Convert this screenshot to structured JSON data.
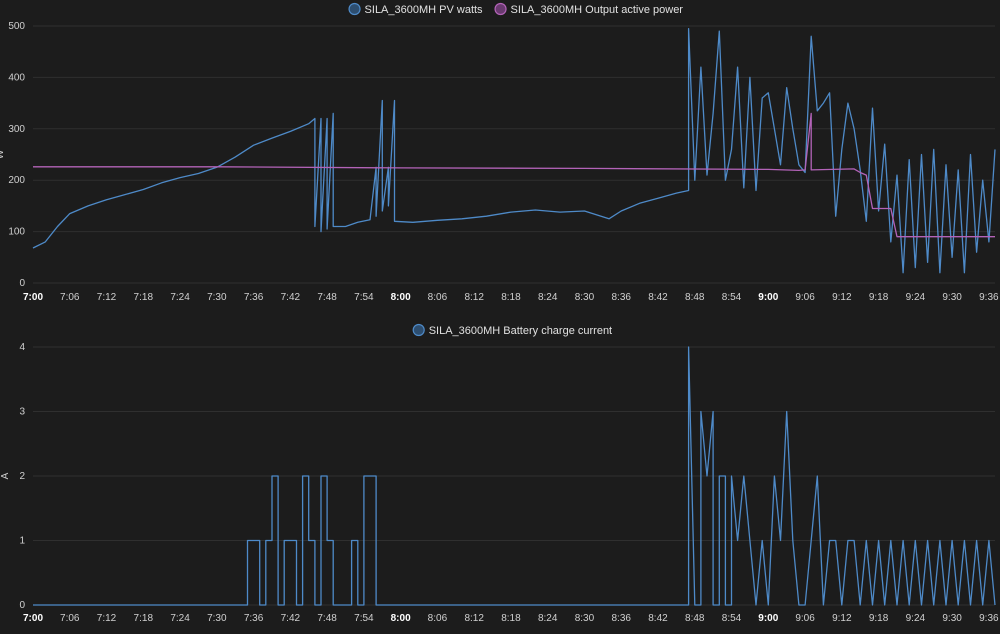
{
  "chart_data": [
    {
      "type": "line",
      "ylabel": "W",
      "ylim": [
        0,
        500
      ],
      "yticks": [
        "0",
        "100",
        "200",
        "300",
        "400",
        "500"
      ],
      "xlim": [
        "7:00",
        "9:37"
      ],
      "xticks": [
        "7:00",
        "7:06",
        "7:12",
        "7:18",
        "7:24",
        "7:30",
        "7:36",
        "7:42",
        "7:48",
        "7:54",
        "8:00",
        "8:06",
        "8:12",
        "8:18",
        "8:24",
        "8:30",
        "8:36",
        "8:42",
        "8:48",
        "8:54",
        "9:00",
        "9:06",
        "9:12",
        "9:18",
        "9:24",
        "9:30",
        "9:36"
      ],
      "bold_ticks": [
        "7:00",
        "8:00",
        "9:00"
      ],
      "legend_placement": "top-center",
      "grid": true,
      "series": [
        {
          "name": "SILA_3600MH PV watts",
          "color": "#4e8ac8",
          "points": [
            [
              "7:00",
              68
            ],
            [
              "7:02",
              80
            ],
            [
              "7:04",
              110
            ],
            [
              "7:06",
              135
            ],
            [
              "7:09",
              150
            ],
            [
              "7:12",
              162
            ],
            [
              "7:15",
              172
            ],
            [
              "7:18",
              182
            ],
            [
              "7:21",
              195
            ],
            [
              "7:24",
              205
            ],
            [
              "7:27",
              213
            ],
            [
              "7:30",
              225
            ],
            [
              "7:33",
              245
            ],
            [
              "7:36",
              268
            ],
            [
              "7:39",
              282
            ],
            [
              "7:42",
              295
            ],
            [
              "7:45",
              310
            ],
            [
              "7:46",
              320
            ],
            [
              "7:46",
              110
            ],
            [
              "7:47",
              320
            ],
            [
              "7:47",
              100
            ],
            [
              "7:48",
              320
            ],
            [
              "7:48",
              105
            ],
            [
              "7:49",
              330
            ],
            [
              "7:49",
              110
            ],
            [
              "7:51",
              110
            ],
            [
              "7:53",
              118
            ],
            [
              "7:55",
              123
            ],
            [
              "7:56",
              225
            ],
            [
              "7:56",
              130
            ],
            [
              "7:57",
              355
            ],
            [
              "7:57",
              140
            ],
            [
              "7:58",
              225
            ],
            [
              "7:58",
              150
            ],
            [
              "7:59",
              355
            ],
            [
              "7:59",
              120
            ],
            [
              "8:02",
              118
            ],
            [
              "8:06",
              122
            ],
            [
              "8:10",
              125
            ],
            [
              "8:14",
              130
            ],
            [
              "8:18",
              138
            ],
            [
              "8:22",
              142
            ],
            [
              "8:26",
              138
            ],
            [
              "8:30",
              140
            ],
            [
              "8:34",
              125
            ],
            [
              "8:36",
              140
            ],
            [
              "8:39",
              155
            ],
            [
              "8:42",
              165
            ],
            [
              "8:45",
              175
            ],
            [
              "8:47",
              180
            ],
            [
              "8:47",
              495
            ],
            [
              "8:48",
              200
            ],
            [
              "8:49",
              420
            ],
            [
              "8:50",
              210
            ],
            [
              "8:51",
              330
            ],
            [
              "8:52",
              490
            ],
            [
              "8:53",
              200
            ],
            [
              "8:54",
              260
            ],
            [
              "8:55",
              420
            ],
            [
              "8:56",
              185
            ],
            [
              "8:57",
              400
            ],
            [
              "8:58",
              180
            ],
            [
              "8:59",
              360
            ],
            [
              "9:00",
              370
            ],
            [
              "9:01",
              300
            ],
            [
              "9:02",
              230
            ],
            [
              "9:03",
              380
            ],
            [
              "9:04",
              300
            ],
            [
              "9:05",
              230
            ],
            [
              "9:06",
              215
            ],
            [
              "9:07",
              480
            ],
            [
              "9:08",
              335
            ],
            [
              "9:09",
              350
            ],
            [
              "9:10",
              370
            ],
            [
              "9:11",
              130
            ],
            [
              "9:12",
              260
            ],
            [
              "9:13",
              350
            ],
            [
              "9:14",
              300
            ],
            [
              "9:15",
              220
            ],
            [
              "9:16",
              120
            ],
            [
              "9:17",
              340
            ],
            [
              "9:18",
              140
            ],
            [
              "9:19",
              270
            ],
            [
              "9:20",
              80
            ],
            [
              "9:21",
              210
            ],
            [
              "9:22",
              20
            ],
            [
              "9:23",
              240
            ],
            [
              "9:24",
              30
            ],
            [
              "9:25",
              250
            ],
            [
              "9:26",
              40
            ],
            [
              "9:27",
              260
            ],
            [
              "9:28",
              20
            ],
            [
              "9:29",
              230
            ],
            [
              "9:30",
              50
            ],
            [
              "9:31",
              220
            ],
            [
              "9:32",
              20
            ],
            [
              "9:33",
              250
            ],
            [
              "9:34",
              60
            ],
            [
              "9:35",
              200
            ],
            [
              "9:36",
              80
            ],
            [
              "9:37",
              260
            ]
          ]
        },
        {
          "name": "SILA_3600MH Output active power",
          "color": "#b363b8",
          "points": [
            [
              "7:00",
              226
            ],
            [
              "7:30",
              226
            ],
            [
              "8:00",
              224
            ],
            [
              "8:30",
              223
            ],
            [
              "9:00",
              221
            ],
            [
              "9:05",
              219
            ],
            [
              "9:06",
              220
            ],
            [
              "9:07",
              330
            ],
            [
              "9:07",
              220
            ],
            [
              "9:14",
              222
            ],
            [
              "9:15",
              215
            ],
            [
              "9:16",
              210
            ],
            [
              "9:17",
              145
            ],
            [
              "9:20",
              145
            ],
            [
              "9:21",
              90
            ],
            [
              "9:37",
              90
            ]
          ]
        }
      ]
    },
    {
      "type": "line",
      "ylabel": "A",
      "ylim": [
        0,
        4
      ],
      "yticks": [
        "0",
        "1",
        "2",
        "3",
        "4"
      ],
      "xlim": [
        "7:00",
        "9:37"
      ],
      "xticks": [
        "7:00",
        "7:06",
        "7:12",
        "7:18",
        "7:24",
        "7:30",
        "7:36",
        "7:42",
        "7:48",
        "7:54",
        "8:00",
        "8:06",
        "8:12",
        "8:18",
        "8:24",
        "8:30",
        "8:36",
        "8:42",
        "8:48",
        "8:54",
        "9:00",
        "9:06",
        "9:12",
        "9:18",
        "9:24",
        "9:30",
        "9:36"
      ],
      "bold_ticks": [
        "7:00",
        "8:00",
        "9:00"
      ],
      "legend_placement": "top-center",
      "grid": true,
      "series": [
        {
          "name": "SILA_3600MH Battery charge current",
          "color": "#4e8ac8",
          "points": [
            [
              "7:00",
              0
            ],
            [
              "7:35",
              0
            ],
            [
              "7:35",
              1
            ],
            [
              "7:37",
              1
            ],
            [
              "7:37",
              0
            ],
            [
              "7:38",
              0
            ],
            [
              "7:38",
              1
            ],
            [
              "7:39",
              1
            ],
            [
              "7:39",
              2
            ],
            [
              "7:40",
              2
            ],
            [
              "7:40",
              0
            ],
            [
              "7:41",
              0
            ],
            [
              "7:41",
              1
            ],
            [
              "7:43",
              1
            ],
            [
              "7:43",
              0
            ],
            [
              "7:44",
              0
            ],
            [
              "7:44",
              2
            ],
            [
              "7:45",
              2
            ],
            [
              "7:45",
              1
            ],
            [
              "7:46",
              1
            ],
            [
              "7:46",
              0
            ],
            [
              "7:47",
              0
            ],
            [
              "7:47",
              2
            ],
            [
              "7:48",
              2
            ],
            [
              "7:48",
              1
            ],
            [
              "7:49",
              1
            ],
            [
              "7:49",
              0
            ],
            [
              "7:52",
              0
            ],
            [
              "7:52",
              1
            ],
            [
              "7:53",
              1
            ],
            [
              "7:53",
              0
            ],
            [
              "7:54",
              0
            ],
            [
              "7:54",
              2
            ],
            [
              "7:56",
              2
            ],
            [
              "7:56",
              0
            ],
            [
              "8:47",
              0
            ],
            [
              "8:47",
              4
            ],
            [
              "8:48",
              0
            ],
            [
              "8:49",
              0
            ],
            [
              "8:49",
              3
            ],
            [
              "8:50",
              2
            ],
            [
              "8:51",
              3
            ],
            [
              "8:51",
              0
            ],
            [
              "8:52",
              0
            ],
            [
              "8:52",
              2
            ],
            [
              "8:53",
              2
            ],
            [
              "8:53",
              0
            ],
            [
              "8:54",
              0
            ],
            [
              "8:54",
              2
            ],
            [
              "8:55",
              1
            ],
            [
              "8:56",
              2
            ],
            [
              "8:57",
              1
            ],
            [
              "8:58",
              0
            ],
            [
              "8:59",
              1
            ],
            [
              "9:00",
              0
            ],
            [
              "9:01",
              2
            ],
            [
              "9:02",
              1
            ],
            [
              "9:03",
              3
            ],
            [
              "9:04",
              1
            ],
            [
              "9:05",
              0
            ],
            [
              "9:06",
              0
            ],
            [
              "9:07",
              1
            ],
            [
              "9:08",
              2
            ],
            [
              "9:09",
              0
            ],
            [
              "9:10",
              1
            ],
            [
              "9:11",
              1
            ],
            [
              "9:12",
              0
            ],
            [
              "9:13",
              1
            ],
            [
              "9:14",
              1
            ],
            [
              "9:15",
              0
            ],
            [
              "9:16",
              1
            ],
            [
              "9:17",
              0
            ],
            [
              "9:18",
              1
            ],
            [
              "9:19",
              0
            ],
            [
              "9:20",
              1
            ],
            [
              "9:21",
              0
            ],
            [
              "9:22",
              1
            ],
            [
              "9:23",
              0
            ],
            [
              "9:24",
              1
            ],
            [
              "9:25",
              0
            ],
            [
              "9:26",
              1
            ],
            [
              "9:27",
              0
            ],
            [
              "9:28",
              1
            ],
            [
              "9:29",
              0
            ],
            [
              "9:30",
              1
            ],
            [
              "9:31",
              0
            ],
            [
              "9:32",
              1
            ],
            [
              "9:33",
              0
            ],
            [
              "9:34",
              1
            ],
            [
              "9:35",
              0
            ],
            [
              "9:36",
              1
            ],
            [
              "9:37",
              0
            ]
          ]
        }
      ]
    }
  ]
}
